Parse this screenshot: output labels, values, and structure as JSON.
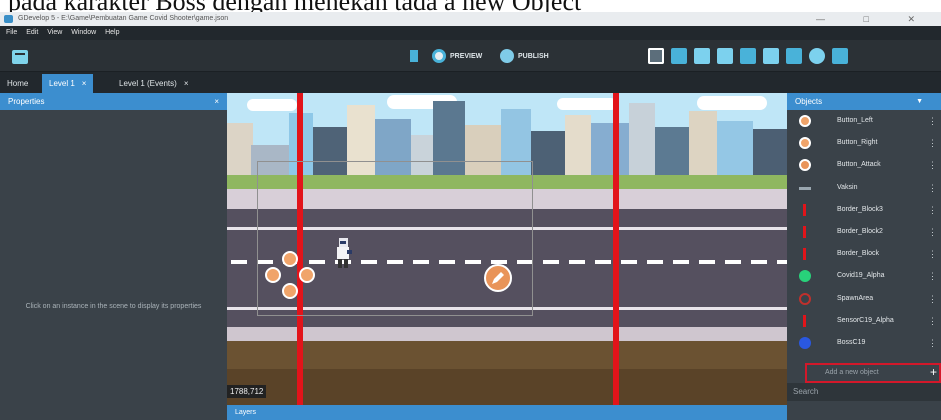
{
  "caption": "pada karakter Boss dengan menekan tada a new Object",
  "window": {
    "title": "GDevelop 5 - E:\\Game\\Pembuatan Game Covid Shooter\\game.json",
    "controls": "— □ ✕"
  },
  "menu": [
    "File",
    "Edit",
    "View",
    "Window",
    "Help"
  ],
  "toolbar": {
    "preview": "PREVIEW",
    "publish": "PUBLISH"
  },
  "tabs": [
    {
      "label": "Home",
      "close": ""
    },
    {
      "label": "Level 1",
      "close": "×"
    },
    {
      "label": "Level 1 (Events)",
      "close": "×"
    }
  ],
  "properties": {
    "title": "Properties",
    "close": "×",
    "empty_message": "Click on an instance in the scene to display its properties"
  },
  "scene": {
    "coords": "1788,712"
  },
  "layers": {
    "title": "Layers"
  },
  "objects": {
    "title": "Objects",
    "chevron": "▼",
    "items": [
      {
        "name": "Button_Left",
        "icon": "arrow-left-icon",
        "dots": "⋮"
      },
      {
        "name": "Button_Right",
        "icon": "arrow-right-icon",
        "dots": "⋮"
      },
      {
        "name": "Button_Attack",
        "icon": "pencil-icon",
        "dots": "⋮"
      },
      {
        "name": "Vaksin",
        "icon": "syringe-icon",
        "dots": "⋮"
      },
      {
        "name": "Border_Block3",
        "icon": "red-bar-icon",
        "dots": "⋮"
      },
      {
        "name": "Border_Block2",
        "icon": "red-bar-icon",
        "dots": "⋮"
      },
      {
        "name": "Border_Block",
        "icon": "red-bar-icon",
        "dots": "⋮"
      },
      {
        "name": "Covid19_Alpha",
        "icon": "virus-green-icon",
        "dots": "⋮"
      },
      {
        "name": "SpawnArea",
        "icon": "target-icon",
        "dots": "⋮"
      },
      {
        "name": "SensorC19_Alpha",
        "icon": "red-bar-icon",
        "dots": "⋮"
      },
      {
        "name": "BossC19",
        "icon": "virus-blue-icon",
        "dots": "⋮"
      }
    ],
    "add_label": "Add a new object",
    "add_plus": "+",
    "search_placeholder": "Search"
  },
  "colors": {
    "accent": "#3c8ecf",
    "border_red": "#e2141a",
    "highlight": "#d3182a"
  }
}
